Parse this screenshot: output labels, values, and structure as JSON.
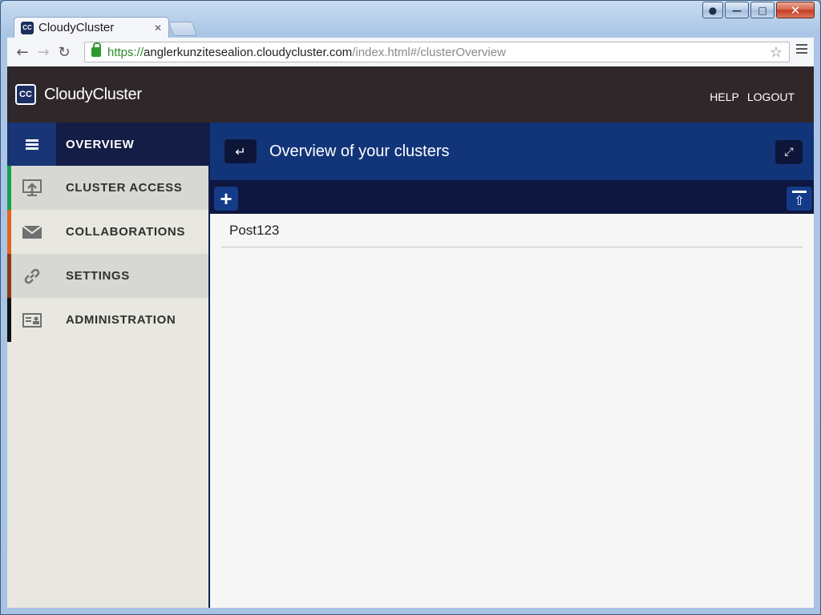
{
  "window": {
    "controls": {
      "user_icon": "user-icon",
      "minimize_icon": "minimize-icon",
      "maximize_icon": "maximize-icon",
      "close_icon": "close-icon"
    }
  },
  "browser": {
    "tab_title": "CloudyCluster",
    "tab_favicon_text": "CC",
    "url_scheme": "https://",
    "url_host": "anglerkunzitesealion.cloudycluster.com",
    "url_path": "/index.html#/clusterOverview"
  },
  "app": {
    "logo_text": "CC",
    "brand": "CloudyCluster",
    "help_label": "HELP",
    "logout_label": "LOGOUT"
  },
  "sidebar": {
    "items": [
      {
        "label": "OVERVIEW",
        "icon": "hamburger-icon",
        "accent": "#131d45"
      },
      {
        "label": "CLUSTER ACCESS",
        "icon": "upload-screen-icon",
        "accent": "#18a048"
      },
      {
        "label": "COLLABORATIONS",
        "icon": "envelope-icon",
        "accent": "#e8641e"
      },
      {
        "label": "SETTINGS",
        "icon": "link-icon",
        "accent": "#8b3a12"
      },
      {
        "label": "ADMINISTRATION",
        "icon": "id-card-icon",
        "accent": "#111111"
      }
    ]
  },
  "main": {
    "title": "Overview of your clusters",
    "clusters": [
      {
        "name": "Post123"
      }
    ]
  },
  "colors": {
    "header_bg": "#2f2729",
    "main_header_bg": "#123579",
    "action_bar_bg": "#0f1640",
    "sidebar_bg": "#e8e7e0"
  }
}
